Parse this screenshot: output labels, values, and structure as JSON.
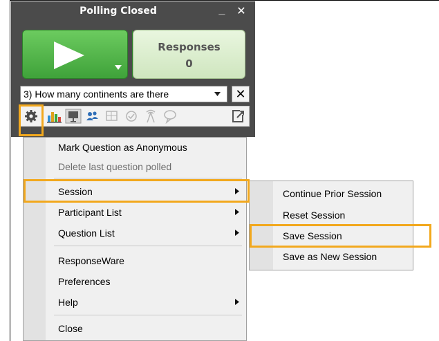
{
  "window": {
    "title": "Polling Closed",
    "minimize_glyph": "_",
    "close_glyph": "✕"
  },
  "responses": {
    "label": "Responses",
    "count": "0"
  },
  "question": {
    "selected": "3) How many continents are there"
  },
  "question_close_glyph": "✕",
  "toolbar": {
    "icons": [
      "gear-icon",
      "bar-chart-icon",
      "presentation-icon",
      "participants-icon",
      "grid-icon",
      "check-circle-icon",
      "antenna-icon",
      "speech-bubble-icon",
      "popout-icon"
    ]
  },
  "main_menu": {
    "items": [
      {
        "label": "Mark Question as Anonymous"
      },
      {
        "label": "Delete last question polled",
        "disabled": true
      },
      {
        "label": "Session",
        "submenu": true
      },
      {
        "label": "Participant List",
        "submenu": true
      },
      {
        "label": "Question List",
        "submenu": true
      },
      {
        "label": "ResponseWare"
      },
      {
        "label": "Preferences"
      },
      {
        "label": "Help",
        "submenu": true
      },
      {
        "label": "Close"
      }
    ]
  },
  "session_menu": {
    "items": [
      {
        "label": "Continue Prior Session"
      },
      {
        "label": "Reset Session"
      },
      {
        "label": "Save Session"
      },
      {
        "label": "Save as New Session"
      }
    ]
  },
  "colors": {
    "highlight": "#f2a81d",
    "start_green": "#4fb244",
    "window_dark": "#4b4b4b"
  }
}
